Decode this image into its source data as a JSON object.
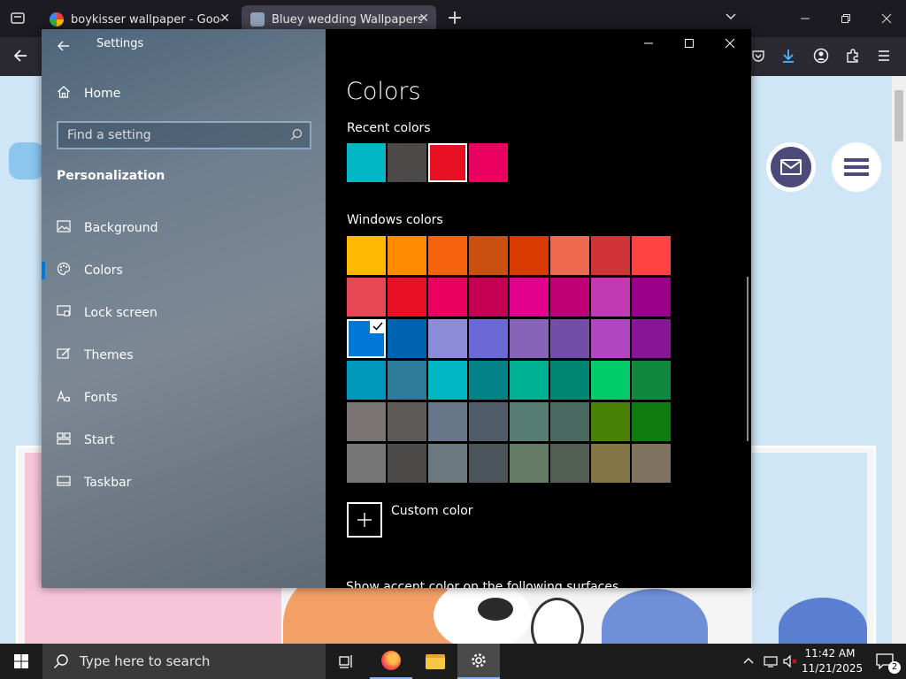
{
  "browser": {
    "tabs": [
      {
        "title": "boykisser wallpaper - Google Se",
        "active": false
      },
      {
        "title": "Bluey wedding Wallpapers - Blu",
        "active": true
      }
    ],
    "new_tab": "+",
    "close_glyph": "✕"
  },
  "settings": {
    "title": "Settings",
    "home": "Home",
    "search_placeholder": "Find a setting",
    "section": "Personalization",
    "nav": [
      {
        "label": "Background",
        "icon": "picture-icon"
      },
      {
        "label": "Colors",
        "icon": "palette-icon"
      },
      {
        "label": "Lock screen",
        "icon": "lock-screen-icon"
      },
      {
        "label": "Themes",
        "icon": "brush-icon"
      },
      {
        "label": "Fonts",
        "icon": "fonts-icon"
      },
      {
        "label": "Start",
        "icon": "start-grid-icon"
      },
      {
        "label": "Taskbar",
        "icon": "taskbar-icon"
      }
    ],
    "selected": "Colors",
    "page_title": "Colors",
    "recent_label": "Recent colors",
    "recent_colors": [
      "#00b7c3",
      "#4c4a48",
      "#e81123",
      "#ea005e"
    ],
    "windows_label": "Windows colors",
    "windows_colors": [
      [
        "#ffb900",
        "#ff8c00",
        "#f7630c",
        "#ca5010",
        "#da3b01",
        "#ef6950",
        "#d13438",
        "#ff4343"
      ],
      [
        "#e74856",
        "#e81123",
        "#ea005e",
        "#c30052",
        "#e3008c",
        "#bf0077",
        "#c239b3",
        "#9a0089"
      ],
      [
        "#0078d7",
        "#0063b1",
        "#8e8cd8",
        "#6b69d6",
        "#8764b8",
        "#744da9",
        "#b146c2",
        "#881798"
      ],
      [
        "#0099bc",
        "#2d7d9a",
        "#00b7c3",
        "#038387",
        "#00b294",
        "#018574",
        "#00cc6a",
        "#10893e"
      ],
      [
        "#7a7574",
        "#5d5a58",
        "#68768a",
        "#515c6b",
        "#567c73",
        "#486860",
        "#498205",
        "#107c10"
      ],
      [
        "#767676",
        "#4c4a48",
        "#69797e",
        "#4a5459",
        "#647c64",
        "#525e54",
        "#847545",
        "#7e735f"
      ]
    ],
    "selected_color": "#0078d7",
    "custom_color": "Custom color",
    "partial_text": "Show accent color on the following surfaces"
  },
  "taskbar": {
    "search_placeholder": "Type here to search",
    "time": "11:42 AM",
    "date": "11/21/2025",
    "notifications": "2"
  }
}
